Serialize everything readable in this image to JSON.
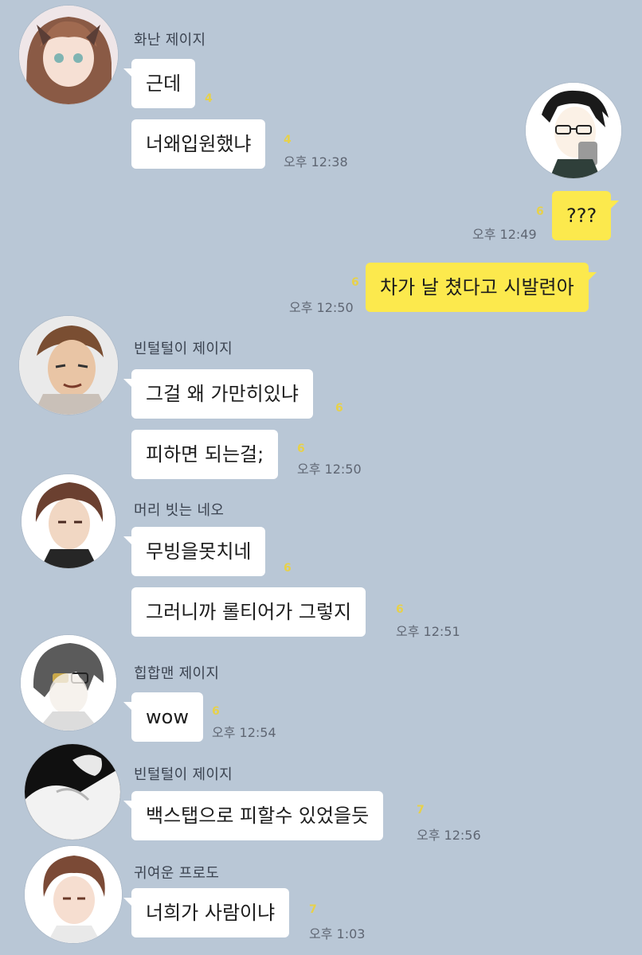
{
  "messages": {
    "m1": {
      "sender": "화난 제이지",
      "b1": "근데",
      "b1_unread": "4",
      "b2": "너왜입원했냐",
      "b2_unread": "4",
      "time": "오후 12:38"
    },
    "m2": {
      "b1": "???",
      "unread": "6",
      "time": "오후 12:49"
    },
    "m3": {
      "b1": "차가 날 쳤다고 시발련아",
      "unread": "6",
      "time": "오후 12:50"
    },
    "m4": {
      "sender": "빈털털이 제이지",
      "b1": "그걸 왜 가만히있냐",
      "b1_unread": "6",
      "b2": "피하면 되는걸;",
      "b2_unread": "6",
      "time": "오후 12:50"
    },
    "m5": {
      "sender": "머리 빗는 네오",
      "b1": "무빙을못치네",
      "b1_unread": "6",
      "b2": "그러니까 롤티어가 그렇지",
      "b2_unread": "6",
      "time": "오후 12:51"
    },
    "m6": {
      "sender": "힙합맨 제이지",
      "b1": "wow",
      "unread": "6",
      "time": "오후 12:54"
    },
    "m7": {
      "sender": "빈털털이 제이지",
      "b1": "백스탭으로 피할수 있었을듯",
      "unread": "7",
      "time": "오후 12:56"
    },
    "m8": {
      "sender": "귀여운 프로도",
      "b1": "너희가 사람이냐",
      "unread": "7",
      "time": "오후 1:03"
    }
  },
  "colors": {
    "background": "#b9c7d6",
    "incoming_bubble": "#ffffff",
    "outgoing_bubble": "#fce94d",
    "unread_count": "#e7d14a"
  }
}
